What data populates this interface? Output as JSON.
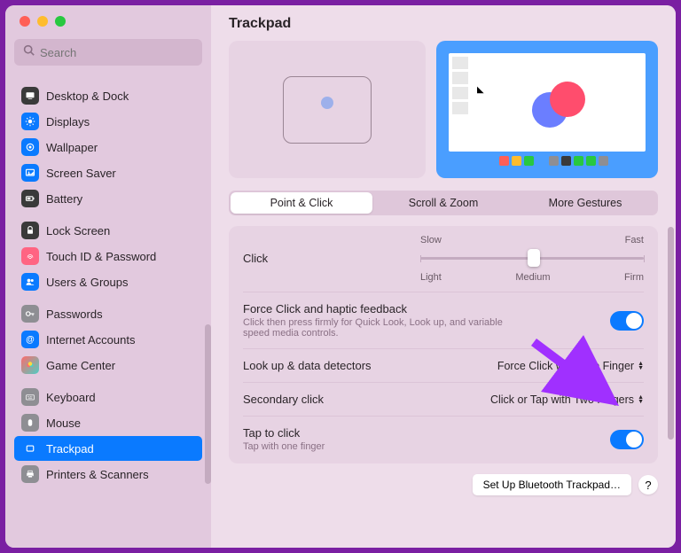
{
  "page_title": "Trackpad",
  "search": {
    "placeholder": "Search"
  },
  "sidebar": {
    "sections": [
      [
        {
          "label": "Desktop & Dock",
          "icon": "desktop-icon",
          "bg": "bg-dark"
        },
        {
          "label": "Displays",
          "icon": "display-icon",
          "bg": "bg-blue"
        },
        {
          "label": "Wallpaper",
          "icon": "wallpaper-icon",
          "bg": "bg-blue"
        },
        {
          "label": "Screen Saver",
          "icon": "screensaver-icon",
          "bg": "bg-blue"
        },
        {
          "label": "Battery",
          "icon": "battery-icon",
          "bg": "bg-dark"
        }
      ],
      [
        {
          "label": "Lock Screen",
          "icon": "lock-icon",
          "bg": "bg-dark"
        },
        {
          "label": "Touch ID & Password",
          "icon": "touchid-icon",
          "bg": "bg-pink"
        },
        {
          "label": "Users & Groups",
          "icon": "users-icon",
          "bg": "bg-blue"
        }
      ],
      [
        {
          "label": "Passwords",
          "icon": "key-icon",
          "bg": "bg-gray"
        },
        {
          "label": "Internet Accounts",
          "icon": "at-icon",
          "bg": "bg-blue"
        },
        {
          "label": "Game Center",
          "icon": "gamecenter-icon",
          "bg": "bg-multi"
        }
      ],
      [
        {
          "label": "Keyboard",
          "icon": "keyboard-icon",
          "bg": "bg-gray"
        },
        {
          "label": "Mouse",
          "icon": "mouse-icon",
          "bg": "bg-gray"
        },
        {
          "label": "Trackpad",
          "icon": "trackpad-icon",
          "bg": "bg-blue",
          "selected": true
        },
        {
          "label": "Printers & Scanners",
          "icon": "printer-icon",
          "bg": "bg-gray"
        }
      ]
    ]
  },
  "tabs": [
    {
      "label": "Point & Click",
      "active": true
    },
    {
      "label": "Scroll & Zoom",
      "active": false
    },
    {
      "label": "More Gestures",
      "active": false
    }
  ],
  "tracking_speed": {
    "labels": {
      "slow": "Slow",
      "fast": "Fast"
    }
  },
  "click": {
    "label": "Click",
    "labels": {
      "light": "Light",
      "medium": "Medium",
      "firm": "Firm"
    }
  },
  "settings": {
    "force_click": {
      "title": "Force Click and haptic feedback",
      "sub": "Click then press firmly for Quick Look, Look up, and variable speed media controls.",
      "enabled": true
    },
    "lookup": {
      "title": "Look up & data detectors",
      "value": "Force Click with One Finger"
    },
    "secondary": {
      "title": "Secondary click",
      "value": "Click or Tap with Two Fingers"
    },
    "tap": {
      "title": "Tap to click",
      "sub": "Tap with one finger",
      "enabled": true
    }
  },
  "bottom": {
    "setup_btn": "Set Up Bluetooth Trackpad…",
    "help": "?"
  },
  "dock_colors": [
    "#4a9eff",
    "#ff5f57",
    "#febc2e",
    "#28c840",
    "#4a9eff",
    "#8e8e93",
    "#3a3a3a",
    "#28c840",
    "#28c840",
    "#8e8e93"
  ]
}
